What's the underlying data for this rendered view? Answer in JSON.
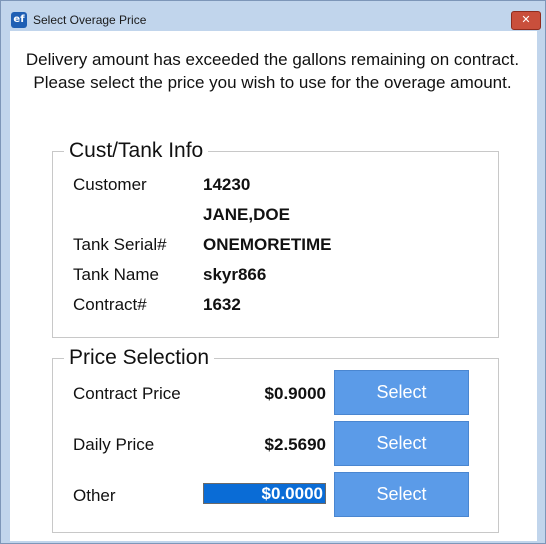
{
  "window": {
    "title": "Select Overage Price",
    "icon_text": "ef",
    "close_glyph": "✕"
  },
  "message": "Delivery amount has exceeded the gallons remaining on contract. Please select the price you wish to use for the overage amount.",
  "cust_tank_info": {
    "legend": "Cust/Tank Info",
    "customer_label": "Customer",
    "customer_number": "14230",
    "customer_name": "JANE,DOE",
    "tank_serial_label": "Tank Serial#",
    "tank_serial": "ONEMORETIME",
    "tank_name_label": "Tank Name",
    "tank_name": "skyr866",
    "contract_label": "Contract#",
    "contract": "1632"
  },
  "price_selection": {
    "legend": "Price Selection",
    "contract_price_label": "Contract Price",
    "contract_price": "$0.9000",
    "daily_price_label": "Daily Price",
    "daily_price": "$2.5690",
    "other_label": "Other",
    "other_value": "$0.0000",
    "select_label": "Select"
  },
  "colors": {
    "select_button": "#5b9be8",
    "other_input_highlight": "#0a6cd6",
    "close_button": "#c94f3c"
  }
}
